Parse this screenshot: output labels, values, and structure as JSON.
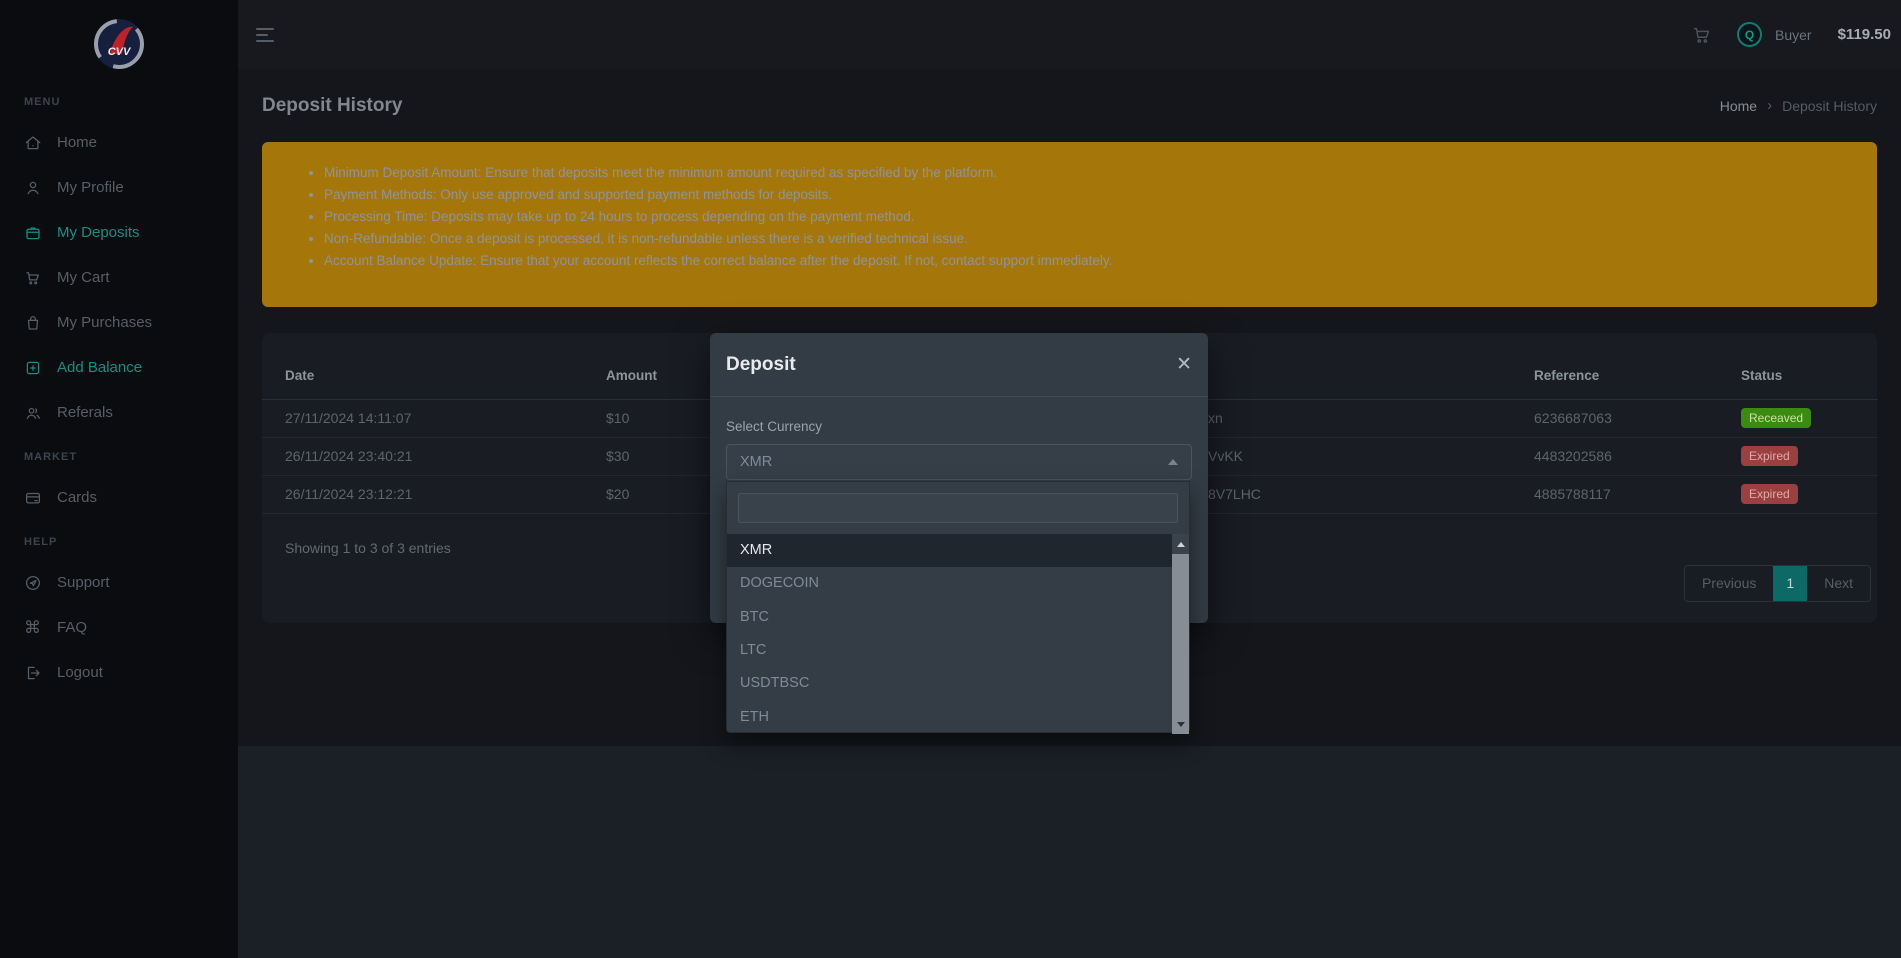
{
  "topbar": {
    "user_role": "Buyer",
    "balance": "$119.50"
  },
  "sidebar": {
    "sections": [
      {
        "label": "MENU",
        "items": [
          {
            "label": "Home",
            "icon": "home-icon",
            "active": false
          },
          {
            "label": "My Profile",
            "icon": "user-icon",
            "active": false
          },
          {
            "label": "My Deposits",
            "icon": "wallet-icon",
            "active": true
          },
          {
            "label": "My Cart",
            "icon": "cart-icon",
            "active": false
          },
          {
            "label": "My Purchases",
            "icon": "bag-icon",
            "active": false
          },
          {
            "label": "Add Balance",
            "icon": "plus-square-icon",
            "active": true
          },
          {
            "label": "Referals",
            "icon": "users-icon",
            "active": false
          }
        ]
      },
      {
        "label": "MARKET",
        "items": [
          {
            "label": "Cards",
            "icon": "credit-card-icon",
            "active": false
          }
        ]
      },
      {
        "label": "HELP",
        "items": [
          {
            "label": "Support",
            "icon": "send-icon",
            "active": false
          },
          {
            "label": "FAQ",
            "icon": "command-icon",
            "active": false
          },
          {
            "label": "Logout",
            "icon": "logout-icon",
            "active": false
          }
        ]
      }
    ]
  },
  "page": {
    "title": "Deposit History",
    "breadcrumb": {
      "home": "Home",
      "separator": "›",
      "current": "Deposit History"
    }
  },
  "notice": {
    "items": [
      "Minimum Deposit Amount: Ensure that deposits meet the minimum amount required as specified by the platform.",
      "Payment Methods: Only use approved and supported payment methods for deposits.",
      "Processing Time: Deposits may take up to 24 hours to process depending on the payment method.",
      "Non-Refundable: Once a deposit is processed, it is non-refundable unless there is a verified technical issue.",
      "Account Balance Update: Ensure that your account reflects the correct balance after the deposit. If not, contact support immediately."
    ]
  },
  "deposits_table": {
    "headers": {
      "date": "Date",
      "amount": "Amount",
      "reference": "Reference",
      "status": "Status"
    },
    "rows": [
      {
        "date": "27/11/2024 14:11:07",
        "amount": "$10",
        "address_fragment": "xn",
        "reference": "6236687063",
        "status": "Receaved"
      },
      {
        "date": "26/11/2024 23:40:21",
        "amount": "$30",
        "address_fragment": "VvKK",
        "reference": "4483202586",
        "status": "Expired"
      },
      {
        "date": "26/11/2024 23:12:21",
        "amount": "$20",
        "address_fragment": "8V7LHC",
        "reference": "4885788117",
        "status": "Expired"
      }
    ],
    "summary": "Showing 1 to 3 of 3 entries",
    "pagination": {
      "previous": "Previous",
      "page": "1",
      "next": "Next"
    }
  },
  "modal": {
    "title": "Deposit",
    "close_glyph": "✕",
    "select_label": "Select Currency",
    "selected_currency": "XMR",
    "search_value": "",
    "options": [
      "XMR",
      "DOGECOIN",
      "BTC",
      "LTC",
      "USDTBSC",
      "ETH"
    ]
  },
  "colors": {
    "sidebar_active_teal": "#148f82",
    "pagination_active": "#0c6965",
    "warning_bg": "#a5770b",
    "status_success_bg": "#3c8a0f",
    "status_danger_bg": "#9c403f",
    "modal_bg": "#333c45"
  }
}
